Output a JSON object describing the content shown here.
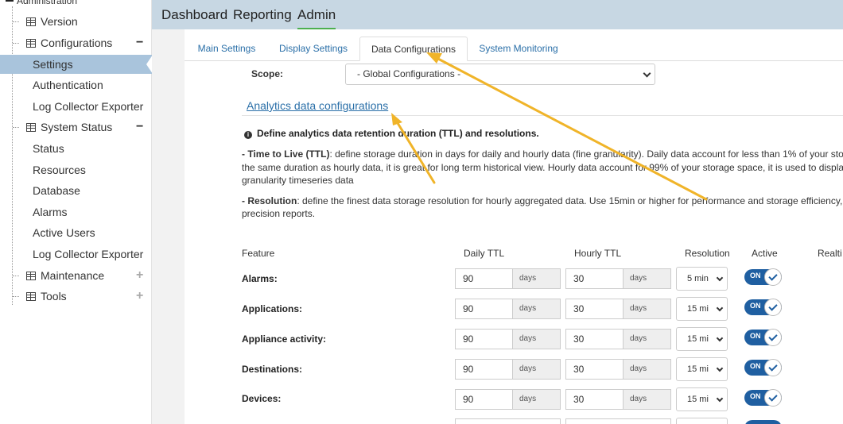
{
  "sidebar": {
    "top_cut": "Administration",
    "items": [
      {
        "label": "Version",
        "kind": "group",
        "toggle": ""
      },
      {
        "label": "Configurations",
        "kind": "group",
        "toggle": "−"
      },
      {
        "label": "Settings",
        "kind": "sub",
        "active": true
      },
      {
        "label": "Authentication",
        "kind": "sub"
      },
      {
        "label": "Log Collector Exporter",
        "kind": "sub"
      },
      {
        "label": "System Status",
        "kind": "group",
        "toggle": "−"
      },
      {
        "label": "Status",
        "kind": "sub"
      },
      {
        "label": "Resources",
        "kind": "sub"
      },
      {
        "label": "Database",
        "kind": "sub"
      },
      {
        "label": "Alarms",
        "kind": "sub"
      },
      {
        "label": "Active Users",
        "kind": "sub"
      },
      {
        "label": "Log Collector Exporter",
        "kind": "sub"
      },
      {
        "label": "Maintenance",
        "kind": "group",
        "toggle": "+"
      },
      {
        "label": "Tools",
        "kind": "group",
        "toggle": "+"
      }
    ]
  },
  "topnav": {
    "dashboard": "Dashboard",
    "reporting": "Reporting",
    "admin": "Admin"
  },
  "tabs": {
    "main_settings": "Main Settings",
    "display_settings": "Display Settings",
    "data_configurations": "Data Configurations",
    "system_monitoring": "System Monitoring"
  },
  "scope": {
    "label": "Scope:",
    "selected": "- Global Configurations -"
  },
  "section": {
    "link": "Analytics data configurations",
    "info": "Define analytics data retention duration (TTL) and resolutions.",
    "ttl_term": "- Time to Live (TTL)",
    "ttl_line1": ": define storage duration in days for daily and hourly data (fine granularity). Daily data account for less than 1% of your storage",
    "ttl_line2": "the same duration as hourly data, it is great for long term historical view. Hourly data account for 99% of your storage space, it is used to display",
    "ttl_line3": "granularity timeseries data",
    "res_term": "- Resolution",
    "res_line1": ": define the finest data storage resolution for hourly aggregated data. Use 15min or higher for performance and storage efficiency, o",
    "res_line2": "precision reports."
  },
  "table": {
    "headers": {
      "feature": "Feature",
      "daily_ttl": "Daily TTL",
      "hourly_ttl": "Hourly TTL",
      "resolution": "Resolution",
      "active": "Active",
      "realtime": "Realti"
    },
    "unit": "days",
    "on_label": "ON",
    "rows": [
      {
        "feature": "Alarms:",
        "daily": "90",
        "hourly": "30",
        "resolution": "5 min"
      },
      {
        "feature": "Applications:",
        "daily": "90",
        "hourly": "30",
        "resolution": "15 mi"
      },
      {
        "feature": "Appliance activity:",
        "daily": "90",
        "hourly": "30",
        "resolution": "15 mi"
      },
      {
        "feature": "Destinations:",
        "daily": "90",
        "hourly": "30",
        "resolution": "15 mi"
      },
      {
        "feature": "Devices:",
        "daily": "90",
        "hourly": "30",
        "resolution": "15 mi"
      }
    ]
  },
  "colors": {
    "topnav_bg": "#c7d7e3",
    "sidebar_active": "#a9c4dc",
    "link": "#2a6fa8",
    "toggle_on": "#1f5fa1",
    "annotation_arrow": "#f0b429"
  }
}
